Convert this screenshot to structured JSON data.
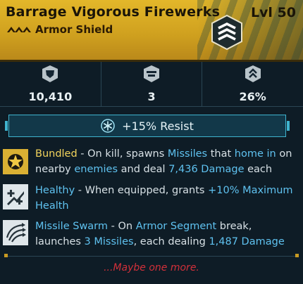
{
  "item": {
    "name": "Barrage Vigorous Firewerks",
    "level": "Lvl 50",
    "type": "Armor Shield",
    "rarity_icon": "triple-chevron-icon",
    "class_icon": "shield-chevron-icon"
  },
  "stats": [
    {
      "icon": "shield-capacity-icon",
      "value": "10,410"
    },
    {
      "icon": "armor-segment-icon",
      "value": "3"
    },
    {
      "icon": "recharge-rate-icon",
      "value": "26%"
    }
  ],
  "resist": {
    "icon": "cryo-snowflake-icon",
    "label": "+15% Resist"
  },
  "perks": [
    {
      "icon": "bundled-star-icon",
      "segments": [
        {
          "text": "Bundled",
          "style": "yellow"
        },
        {
          "text": " - On kill, spawns ",
          "style": "plain"
        },
        {
          "text": "Missiles",
          "style": "cyan"
        },
        {
          "text": " that ",
          "style": "plain"
        },
        {
          "text": "home in",
          "style": "cyan"
        },
        {
          "text": " on nearby ",
          "style": "plain"
        },
        {
          "text": "enemies",
          "style": "cyan"
        },
        {
          "text": " and deal ",
          "style": "plain"
        },
        {
          "text": "7,436 Damage",
          "style": "cyan"
        },
        {
          "text": " each",
          "style": "plain"
        }
      ]
    },
    {
      "icon": "healthy-heal-icon",
      "segments": [
        {
          "text": "Healthy",
          "style": "cyan"
        },
        {
          "text": " - When equipped, grants ",
          "style": "plain"
        },
        {
          "text": "+10% Maximum Health",
          "style": "cyan"
        }
      ]
    },
    {
      "icon": "missile-swarm-icon",
      "segments": [
        {
          "text": "Missile Swarm",
          "style": "cyan"
        },
        {
          "text": " - On ",
          "style": "plain"
        },
        {
          "text": "Armor Segment",
          "style": "cyan"
        },
        {
          "text": " break, launches ",
          "style": "plain"
        },
        {
          "text": "3 Missiles",
          "style": "cyan"
        },
        {
          "text": ", each dealing ",
          "style": "plain"
        },
        {
          "text": "1,487 Damage",
          "style": "cyan"
        }
      ]
    }
  ],
  "flavor_text": "...Maybe one more.",
  "colors": {
    "header_gold": "#d9ad26",
    "panel": "#0e1c26",
    "accent_cyan": "#5fc2f0",
    "highlight_yellow": "#f2d45c",
    "flavor_red": "#d3303a"
  }
}
